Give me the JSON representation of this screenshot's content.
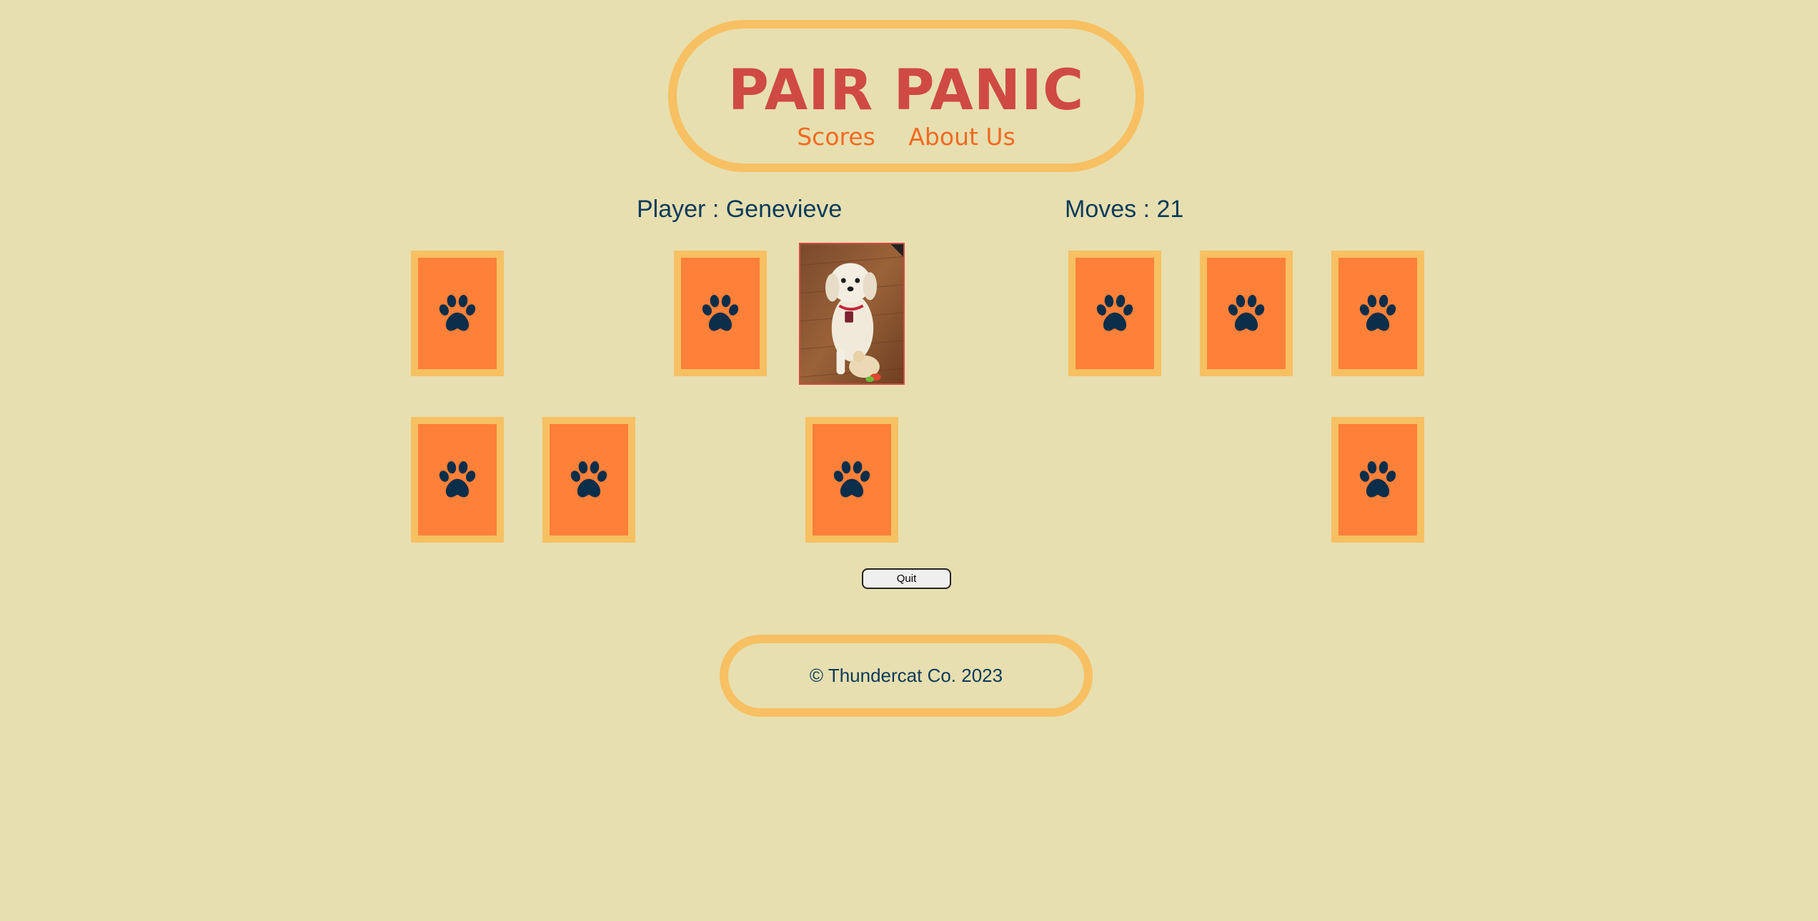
{
  "colors": {
    "background": "#e7dfb0",
    "accent_border": "#f7c062",
    "title": "#cf4a43",
    "nav_link": "#f26a21",
    "text_dark": "#0b3a5a",
    "card_back": "#ff8038",
    "paw": "#0b2e4a"
  },
  "header": {
    "title": "PAIR PANIC",
    "nav": {
      "scores": "Scores",
      "about": "About Us"
    }
  },
  "status": {
    "player": "Player : Genevieve",
    "moves": "Moves : 21"
  },
  "board": {
    "card_icon": "paw-icon",
    "revealed_card": "dog-photo",
    "cards": [
      {
        "row": 1,
        "col": 1,
        "state": "hidden"
      },
      {
        "row": 1,
        "col": 2,
        "state": "matched"
      },
      {
        "row": 1,
        "col": 3,
        "state": "hidden"
      },
      {
        "row": 1,
        "col": 4,
        "state": "revealed"
      },
      {
        "row": 1,
        "col": 5,
        "state": "matched"
      },
      {
        "row": 1,
        "col": 6,
        "state": "hidden"
      },
      {
        "row": 1,
        "col": 7,
        "state": "hidden"
      },
      {
        "row": 1,
        "col": 8,
        "state": "hidden"
      },
      {
        "row": 2,
        "col": 1,
        "state": "hidden"
      },
      {
        "row": 2,
        "col": 2,
        "state": "hidden"
      },
      {
        "row": 2,
        "col": 3,
        "state": "matched"
      },
      {
        "row": 2,
        "col": 4,
        "state": "hidden"
      },
      {
        "row": 2,
        "col": 5,
        "state": "matched"
      },
      {
        "row": 2,
        "col": 6,
        "state": "matched"
      },
      {
        "row": 2,
        "col": 7,
        "state": "matched"
      },
      {
        "row": 2,
        "col": 8,
        "state": "hidden"
      }
    ]
  },
  "controls": {
    "quit_label": "Quit"
  },
  "footer": {
    "copyright": "© Thundercat Co. 2023"
  }
}
